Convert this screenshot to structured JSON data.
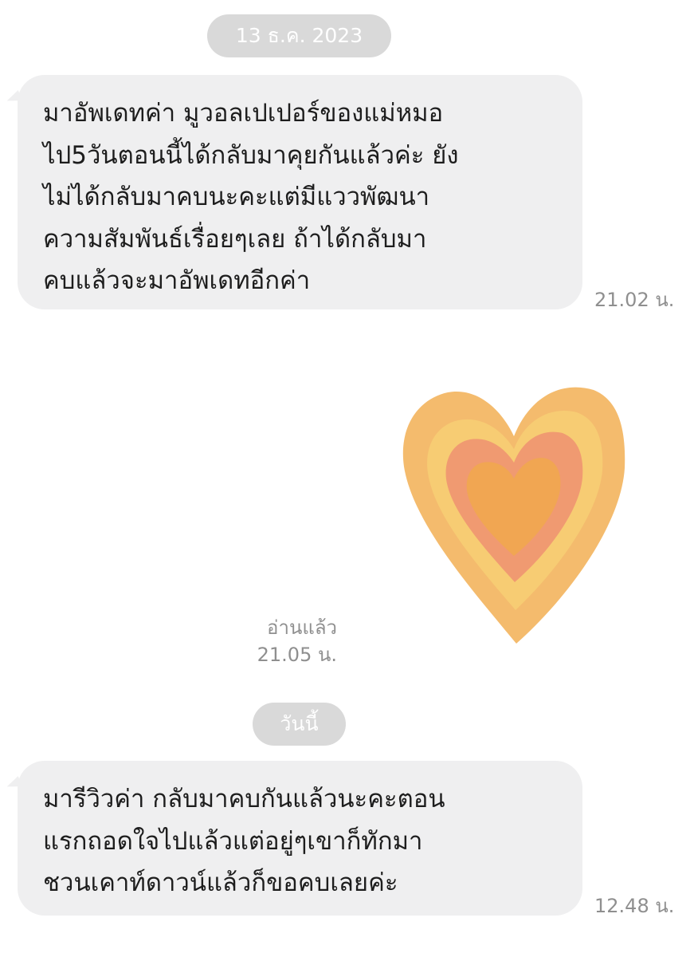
{
  "chat": {
    "date_separators": [
      "13 ธ.ค. 2023",
      "วันนี้"
    ],
    "messages": [
      {
        "sender": "other",
        "lines": [
          "มาอัพเดทค่า มูวอลเปเปอร์ของแม่หมอ",
          "ไป5วันตอนนี้ได้กลับมาคุยกันแล้วค่ะ ยัง",
          "ไม่ได้กลับมาคบนะคะแต่มีแววพัฒนา",
          "ความสัมพันธ์เรื่อยๆเลย ถ้าได้กลับมา",
          "คบแล้วจะมาอัพเดทอีกค่า"
        ],
        "time": "21.02 น."
      },
      {
        "sender": "me",
        "sticker": "layered-heart-sticker",
        "read_label": "อ่านแล้ว",
        "time": "21.05 น."
      },
      {
        "sender": "other",
        "lines": [
          "มารีวิวค่า กลับมาคบกันแล้วนะคะตอน",
          "แรกถอดใจไปแล้วแต่อยู่ๆเขาก็ทักมา",
          "ชวนเคาท์ดาวน์แล้วก็ขอคบเลยค่ะ"
        ],
        "time": "12.48 น."
      }
    ]
  },
  "colors": {
    "bubble": "#efeff0",
    "date_pill": "#d9d9d9",
    "meta_text": "#8f8f8f",
    "heart_outer": "#f4bb6d",
    "heart_band2": "#f7cc73",
    "heart_band3": "#f09a71",
    "heart_inner": "#f1a652"
  }
}
